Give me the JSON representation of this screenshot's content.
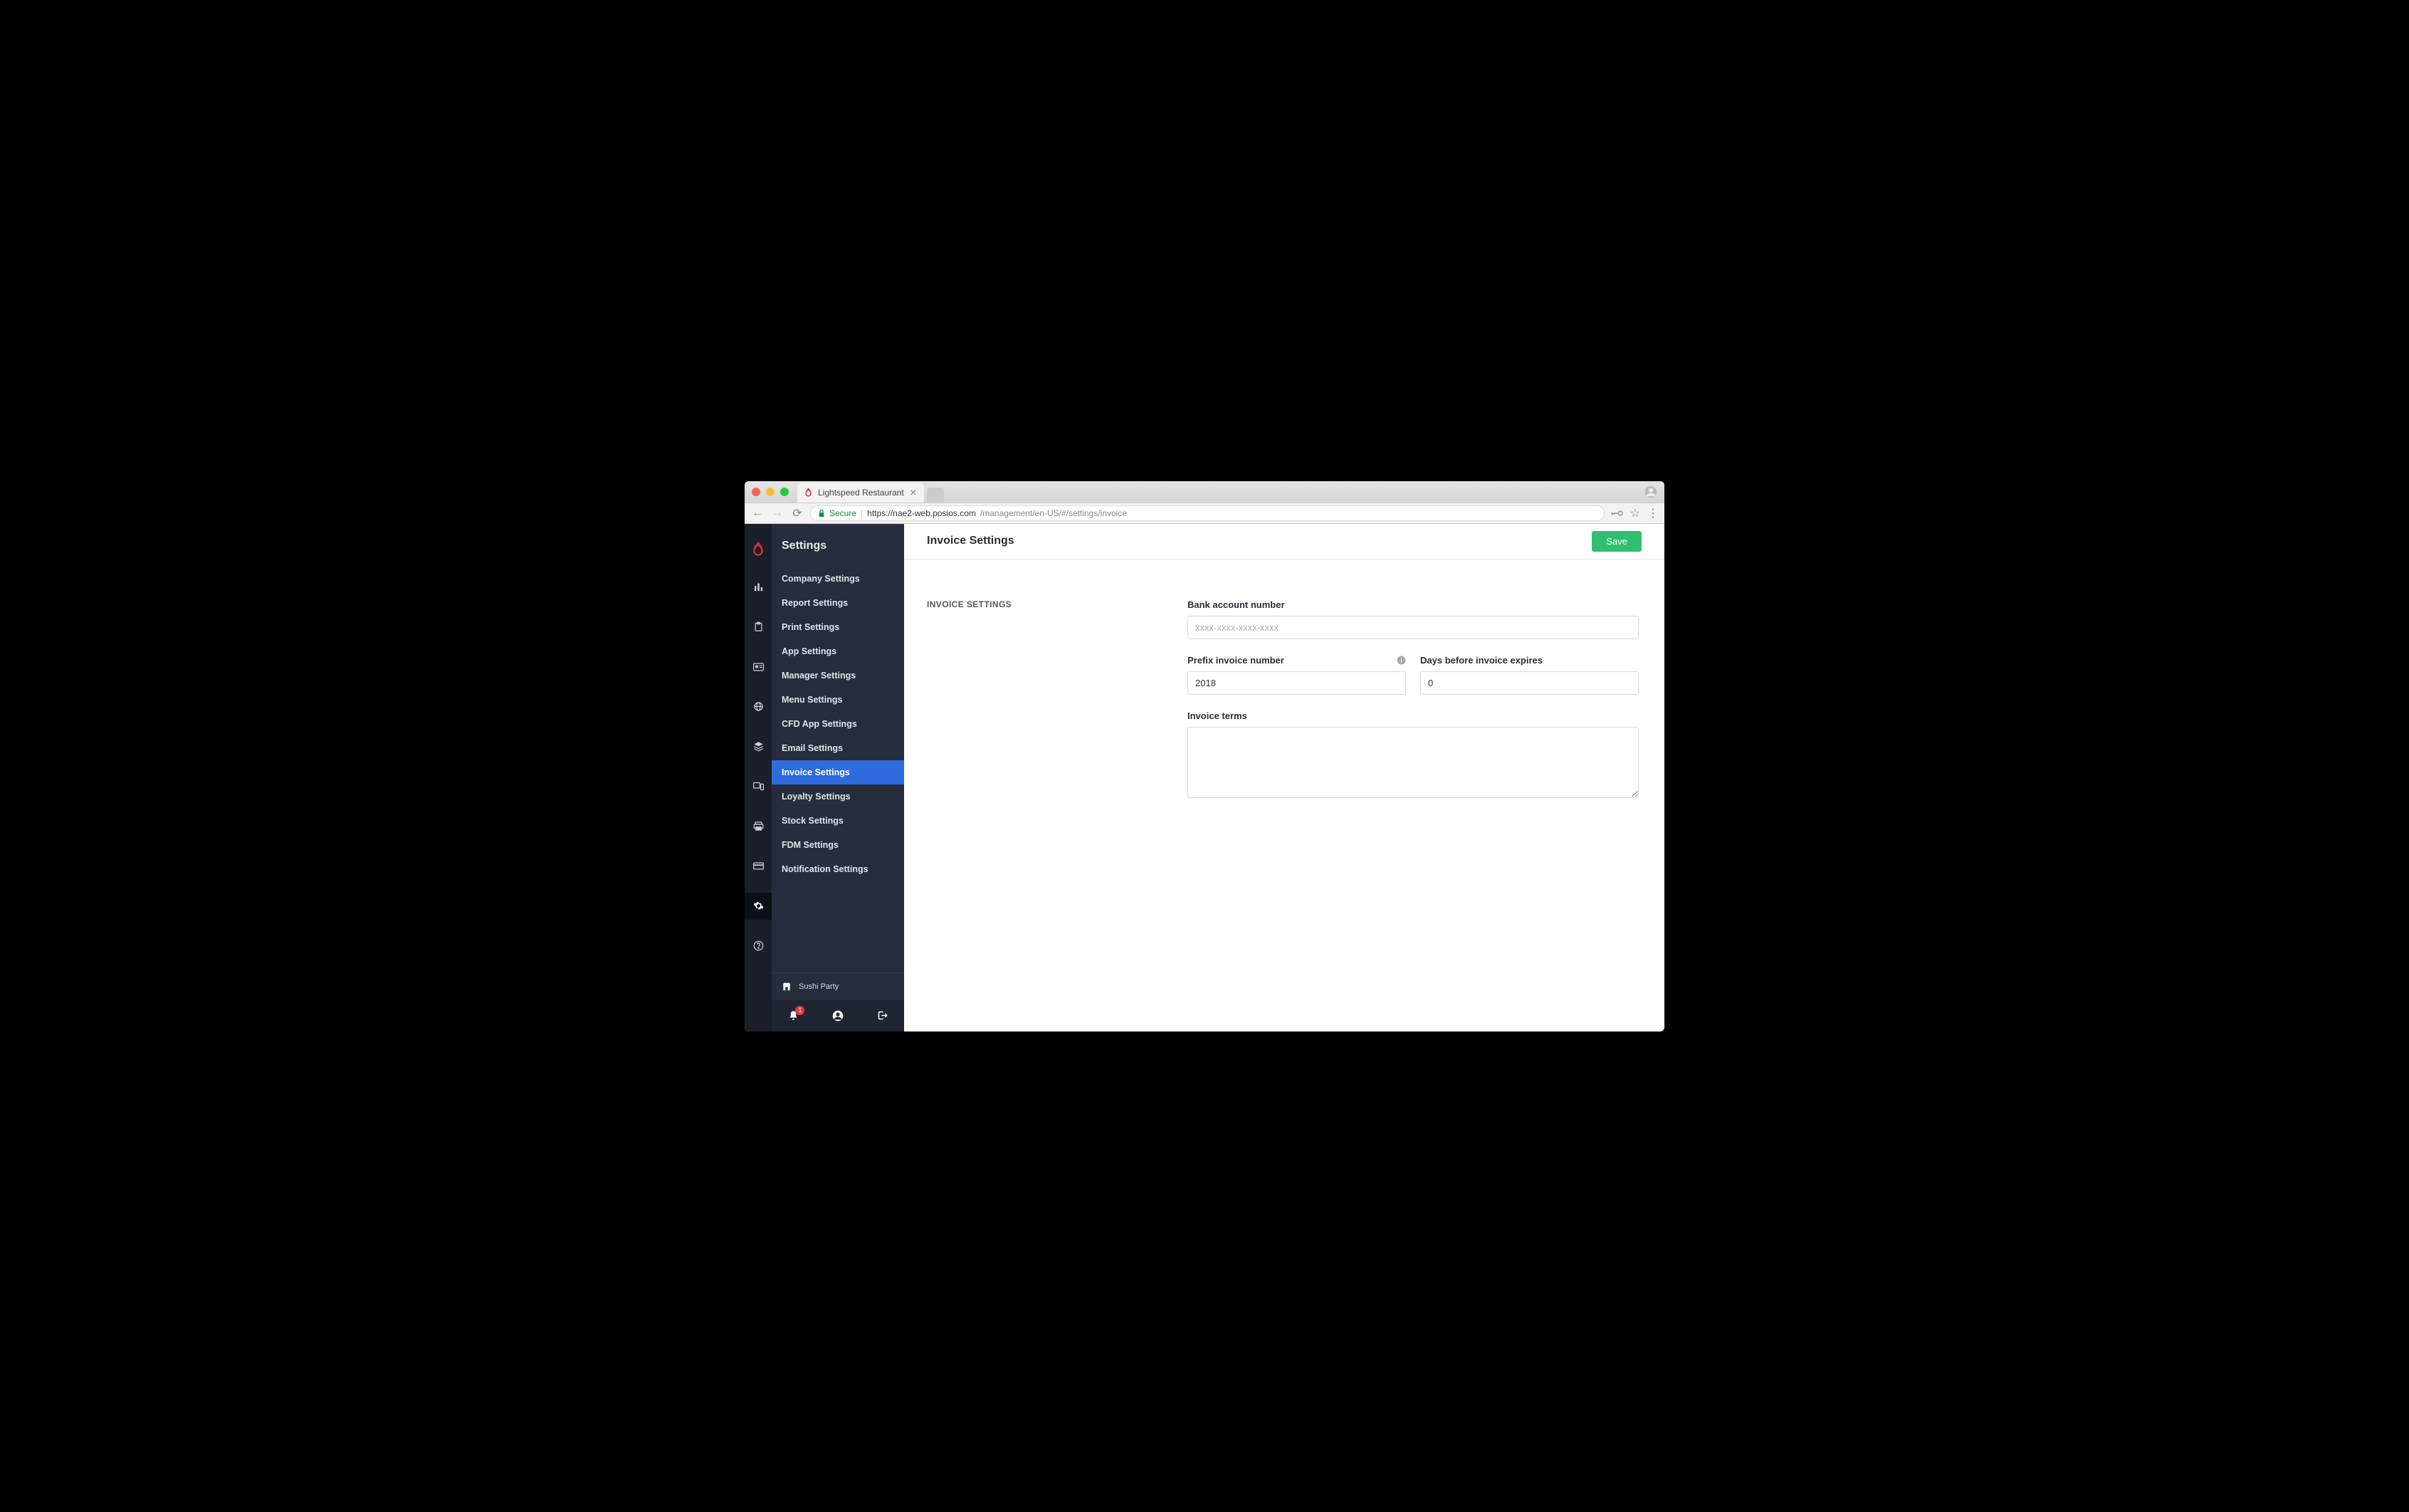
{
  "browser": {
    "tab_title": "Lightspeed Restaurant",
    "secure_label": "Secure",
    "url_host": "https://nae2-web.posios.com",
    "url_path": "/management/en-US/#/settings/invoice"
  },
  "sidebar": {
    "title": "Settings",
    "items": [
      {
        "label": "Company Settings"
      },
      {
        "label": "Report Settings"
      },
      {
        "label": "Print Settings"
      },
      {
        "label": "App Settings"
      },
      {
        "label": "Manager Settings"
      },
      {
        "label": "Menu Settings"
      },
      {
        "label": "CFD App Settings"
      },
      {
        "label": "Email Settings"
      },
      {
        "label": "Invoice Settings"
      },
      {
        "label": "Loyalty Settings"
      },
      {
        "label": "Stock Settings"
      },
      {
        "label": "FDM Settings"
      },
      {
        "label": "Notification Settings"
      }
    ],
    "active_index": 8,
    "account_name": "Sushi Party",
    "notification_count": "1"
  },
  "page": {
    "title": "Invoice Settings",
    "save_label": "Save",
    "section_label": "INVOICE SETTINGS",
    "fields": {
      "bank_label": "Bank account number",
      "bank_placeholder": "xxxx-xxxx-xxxx-xxxx",
      "bank_value": "",
      "prefix_label": "Prefix invoice number",
      "prefix_value": "2018",
      "expires_label": "Days before invoice expires",
      "expires_value": "0",
      "terms_label": "Invoice terms",
      "terms_value": ""
    }
  }
}
